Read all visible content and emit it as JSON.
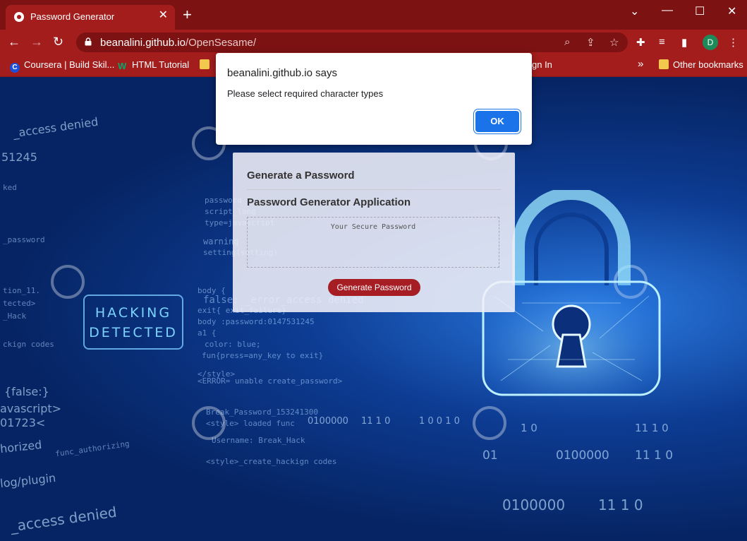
{
  "browser": {
    "tab_title": "Password Generator",
    "url_domain": "beanalini.github.io",
    "url_path": "/OpenSesame/",
    "profile_initial": "D"
  },
  "bookmarks": {
    "items": [
      {
        "label": "Coursera | Build Skil...",
        "icon": "coursera-icon",
        "color": "#1f4fd6"
      },
      {
        "label": "HTML Tutorial",
        "icon": "w3schools-icon",
        "color": "#04aa6d"
      },
      {
        "label": "gn In",
        "icon": "folder-icon",
        "color": "#f2c94c"
      }
    ],
    "overflow": "»",
    "other": "Other bookmarks"
  },
  "background": {
    "hacking_line1": "HACKING",
    "hacking_line2": "DETECTED",
    "code_lines": [
      "_access denied",
      "51245",
      "ked",
      "_password",
      "tion_11.",
      "tected>",
      "_Hack",
      "ckign codes",
      "{false:}",
      "avascript>",
      "01723<",
      "horized",
      "func_authorizing",
      "log/plugin",
      "_access denied",
      "password",
      "script_lang",
      "type=javascript",
      "warning",
      "setting(setting)",
      "body {",
      "false: _error_access denied",
      "exit{ exit_failure}",
      "body :password:0147531245",
      "a1 {",
      "color: blue;",
      "fun{press=any_key to exit}",
      "</style>",
      "<ERROR= unable create_password>",
      "Break_Password_153241300",
      "<style> loaded func",
      "Username: Break_Hack",
      "<style>_create_hackign codes",
      "0100000",
      "11 1 0",
      "1 0 0 1 0",
      "1 0",
      "11 1 0",
      "0100000",
      "11 1 0",
      "01",
      "0100000",
      "11 1 0"
    ]
  },
  "app": {
    "title": "Generate a Password",
    "subtitle": "Password Generator Application",
    "password_placeholder": "Your Secure Password",
    "generate_label": "Generate Password"
  },
  "dialog": {
    "title": "beanalini.github.io says",
    "message": "Please select required character types",
    "ok_label": "OK"
  },
  "colors": {
    "chrome_dark": "#7d1212",
    "chrome": "#a31d1d",
    "button_red": "#a61d24",
    "ok_blue": "#1a73e8"
  }
}
